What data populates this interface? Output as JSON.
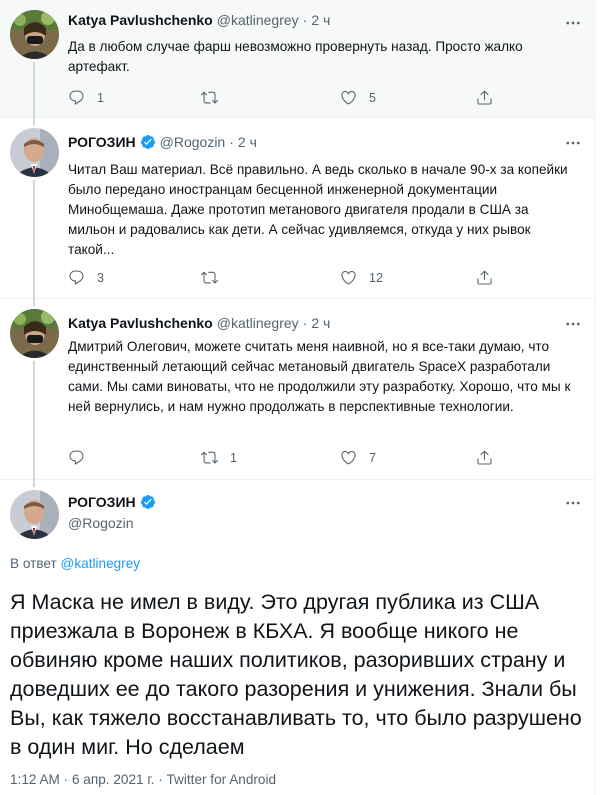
{
  "tweets": [
    {
      "name": "Katya Pavlushchenko",
      "handle": "@katlinegrey",
      "dot": "·",
      "time": "2 ч",
      "text": "Да в любом случае фарш невозможно провернуть назад. Просто жалко артефакт.",
      "replies": "1",
      "retweets": "",
      "likes": "5"
    },
    {
      "name": "РОГОЗИН",
      "handle": "@Rogozin",
      "dot": "·",
      "time": "2 ч",
      "text": "Читал Ваш материал. Всё правильно. А ведь сколько в начале 90-х за копейки было передано иностранцам бесценной инженерной документации Минобщемаша. Даже прототип метанового двигателя продали в США за мильон и радовались как дети. А сейчас удивляемся, откуда у них рывок такой...",
      "replies": "3",
      "retweets": "",
      "likes": "12"
    },
    {
      "name": "Katya Pavlushchenko",
      "handle": "@katlinegrey",
      "dot": "·",
      "time": "2 ч",
      "text": "Дмитрий Олегович, можете считать меня наивной, но я все-таки думаю, что единственный летающий сейчас метановый двигатель SpaceX разработали сами. Мы сами виноваты, что не продолжили эту разработку. Хорошо, что мы к ней вернулись, и нам нужно продолжать в перспективные технологии.",
      "replies": "",
      "retweets": "1",
      "likes": "7"
    }
  ],
  "main": {
    "name": "РОГОЗИН",
    "handle": "@Rogozin",
    "reply_prefix": "В ответ",
    "reply_handle": "@katlinegrey",
    "text": "Я Маска не имел в виду. Это другая публика из США приезжала в Воронеж в КБХА. Я вообще никого не обвиняю кроме наших политиков, разоривших страну и доведших ее до такого разорения и унижения. Знали бы Вы, как тяжело восстанавливать то, что было разрушено в один миг. Но сделаем",
    "meta": "1:12 AM · 6 апр. 2021 г. · Twitter for Android"
  },
  "colors": {
    "accent": "#1d9bf0",
    "text": "#0f1419",
    "secondary": "#536471",
    "verified": "#1d9bf0"
  },
  "icons": [
    "reply-icon",
    "retweet-icon",
    "like-icon",
    "share-icon",
    "more-icon",
    "verified-icon"
  ]
}
